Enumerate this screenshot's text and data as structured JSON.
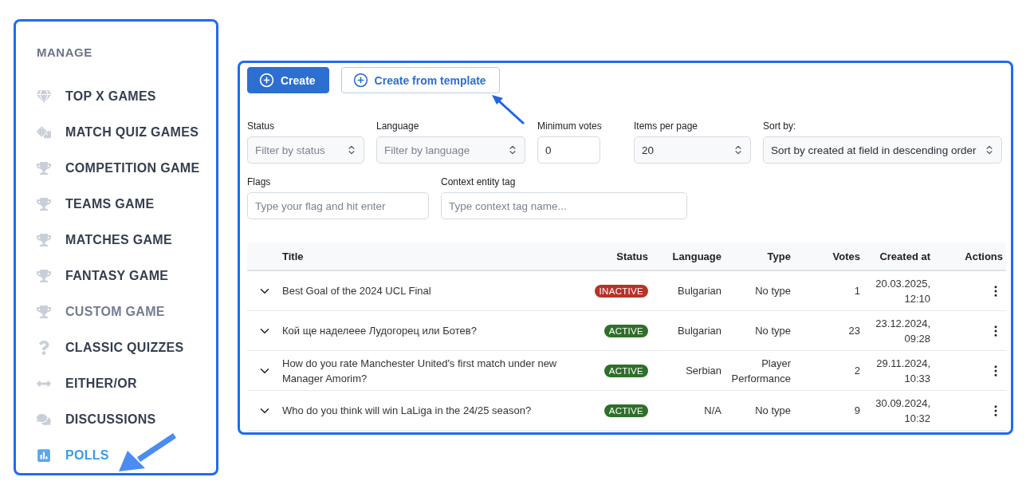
{
  "sidebar": {
    "heading": "MANAGE",
    "items": [
      {
        "label": "TOP X GAMES",
        "kind": "gem",
        "selected": false,
        "disabled": false
      },
      {
        "label": "MATCH QUIZ GAMES",
        "kind": "dice",
        "selected": false,
        "disabled": false
      },
      {
        "label": "COMPETITION GAME",
        "kind": "trophy",
        "selected": false,
        "disabled": false
      },
      {
        "label": "TEAMS GAME",
        "kind": "trophy",
        "selected": false,
        "disabled": false
      },
      {
        "label": "MATCHES GAME",
        "kind": "trophy",
        "selected": false,
        "disabled": false
      },
      {
        "label": "FANTASY GAME",
        "kind": "trophy",
        "selected": false,
        "disabled": false
      },
      {
        "label": "CUSTOM GAME",
        "kind": "trophy",
        "selected": false,
        "disabled": true
      },
      {
        "label": "CLASSIC QUIZZES",
        "kind": "question",
        "selected": false,
        "disabled": false
      },
      {
        "label": "EITHER/OR",
        "kind": "arrows",
        "selected": false,
        "disabled": false
      },
      {
        "label": "DISCUSSIONS",
        "kind": "comments",
        "selected": false,
        "disabled": false
      },
      {
        "label": "POLLS",
        "kind": "poll",
        "selected": true,
        "disabled": false
      }
    ]
  },
  "toolbar": {
    "buttons": [
      {
        "label": "Create",
        "kind": "primary"
      },
      {
        "label": "Create from template",
        "kind": "outline"
      }
    ]
  },
  "filters": [
    {
      "label": "Status",
      "kind": "select",
      "placeholder": "Filter by status"
    },
    {
      "label": "Language",
      "kind": "select",
      "placeholder": "Filter by language"
    },
    {
      "label": "Minimum votes",
      "kind": "input",
      "value": "0"
    },
    {
      "label": "Items per page",
      "kind": "select",
      "value": "20"
    },
    {
      "label": "Sort by:",
      "kind": "select",
      "value": "Sort by created at field in descending order"
    },
    {
      "label": "Flags",
      "kind": "input",
      "placeholder": "Type your flag and hit enter"
    },
    {
      "label": "Context entity tag",
      "kind": "input",
      "placeholder": "Type context tag name..."
    }
  ],
  "table": {
    "columns": [
      "Title",
      "Status",
      "Language",
      "Type",
      "Votes",
      "Created at",
      "Actions"
    ],
    "rows": [
      {
        "title": "Best Goal of the 2024 UCL Final",
        "status": "INACTIVE",
        "color": "#b83228",
        "language": "Bulgarian",
        "type": "No type",
        "votes": "1",
        "created_at": "20.03.2025, 12:10"
      },
      {
        "title": "Кой ще наделеее Лудогорец или Ботев?",
        "status": "ACTIVE",
        "color": "#2f6f2a",
        "language": "Bulgarian",
        "type": "No type",
        "votes": "23",
        "created_at": "23.12.2024, 09:28"
      },
      {
        "title": "How do you rate Manchester United's first match under new Manager Amorim?",
        "status": "ACTIVE",
        "color": "#2f6f2a",
        "language": "Serbian",
        "type": "Player Performance",
        "votes": "2",
        "created_at": "29.11.2024, 10:33"
      },
      {
        "title": "Who do you think will win LaLiga in the 24/25 season?",
        "status": "ACTIVE",
        "color": "#2f6f2a",
        "language": "N/A",
        "type": "No type",
        "votes": "9",
        "created_at": "30.09.2024, 10:32"
      }
    ]
  }
}
